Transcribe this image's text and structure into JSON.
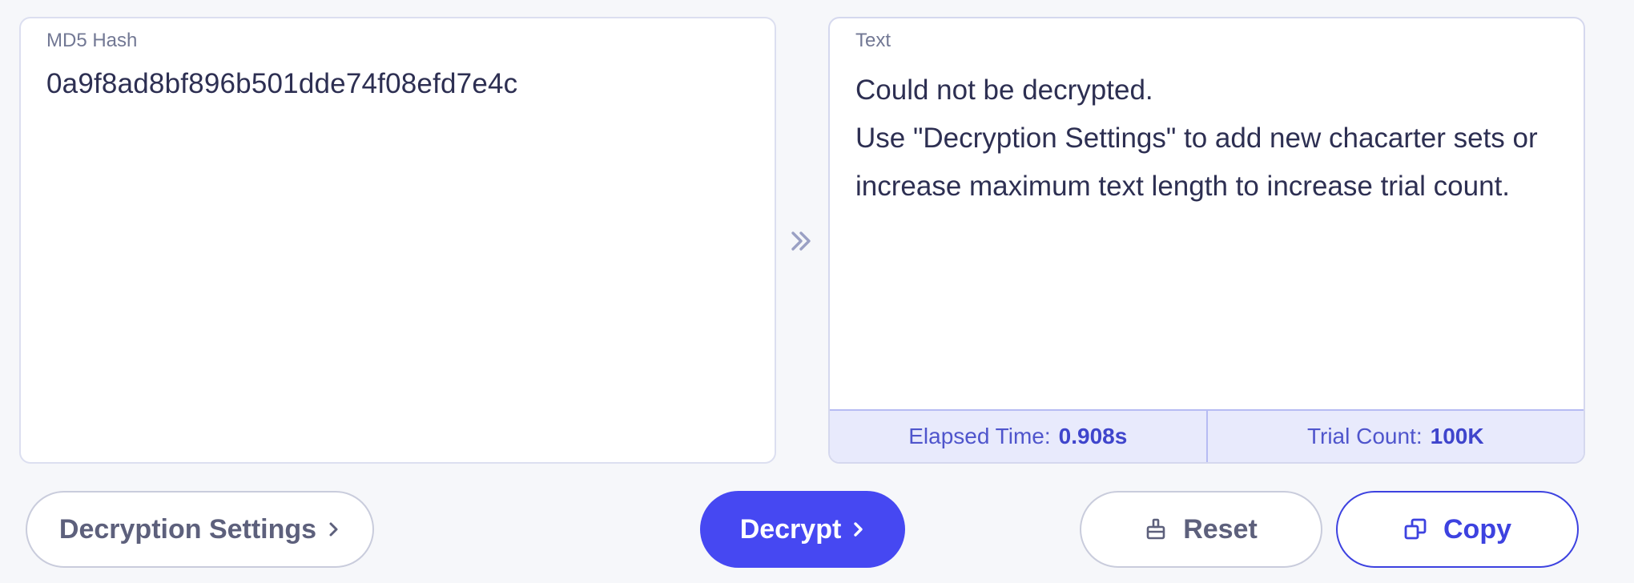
{
  "input_panel": {
    "label": "MD5 Hash",
    "value": "0a9f8ad8bf896b501dde74f08efd7e4c"
  },
  "output_panel": {
    "label": "Text",
    "lines": [
      "Could not be decrypted.",
      "Use \"Decryption Settings\" to add new chacarter sets or",
      "increase maximum text length to increase trial count."
    ]
  },
  "stats": {
    "elapsed_label": "Elapsed Time:",
    "elapsed_value": "0.908s",
    "trial_label": "Trial Count:",
    "trial_value": "100K"
  },
  "buttons": {
    "settings_label": "Decryption Settings",
    "decrypt_label": "Decrypt",
    "reset_label": "Reset",
    "copy_label": "Copy"
  },
  "icons": {
    "arrow": "double-chevron-right-icon",
    "settings_chevron": "chevron-right-icon",
    "decrypt_chevron": "chevron-right-icon",
    "reset": "eraser-icon",
    "copy": "copy-icon"
  },
  "colors": {
    "accent": "#4648f2",
    "stats_bg": "#e8eafc",
    "text": "#2d2f52",
    "muted": "#727894"
  }
}
